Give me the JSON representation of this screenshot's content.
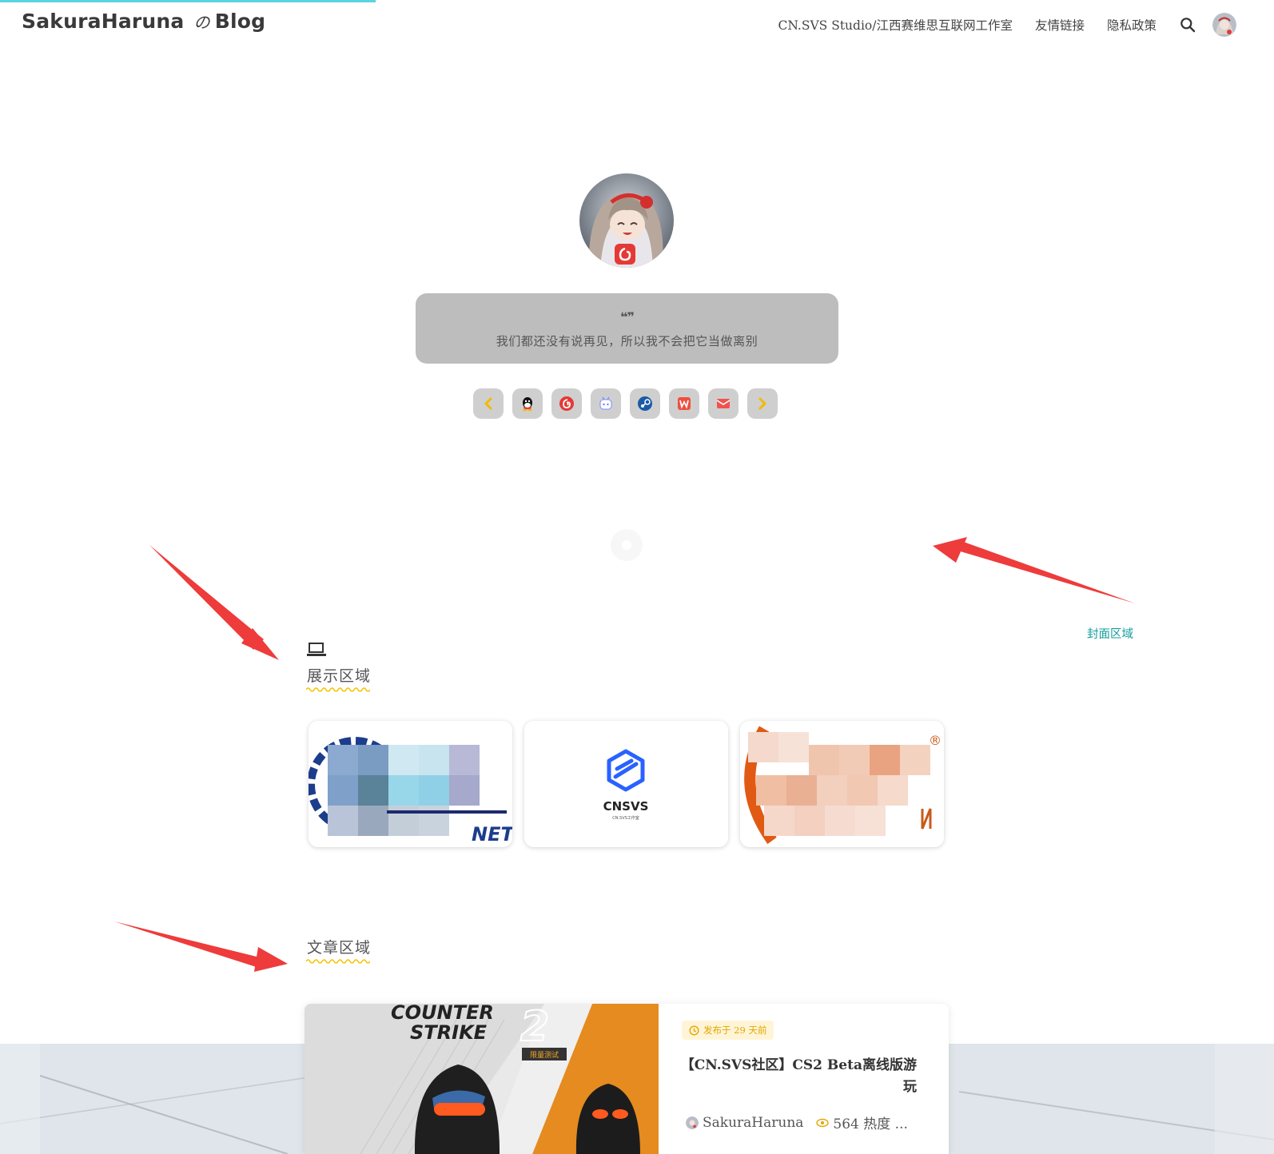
{
  "header": {
    "brand_main": "SakuraHaruna",
    "brand_no": "の",
    "brand_blog": "Blog",
    "nav": [
      {
        "label": "CN.SVS Studio/江西赛维思互联网工作室"
      },
      {
        "label": "友情链接"
      },
      {
        "label": "隐私政策"
      }
    ],
    "icons": {
      "search": "search-icon",
      "avatar": "user-avatar"
    }
  },
  "hero": {
    "quote_mark": "❝❞",
    "quote": "我们都还没有说再见，所以我不会把它当做离别",
    "social_icons": [
      "prev-arrow-icon",
      "qq-icon",
      "netease-music-icon",
      "bilibili-icon",
      "steam-icon",
      "wps-icon",
      "email-icon",
      "next-arrow-icon"
    ]
  },
  "annotations": {
    "cover_label": "封面区域"
  },
  "sections": {
    "showcase_title": "展示区域",
    "articles_title": "文章区域"
  },
  "showcase_cards": [
    {
      "name": "blurred-logo-1",
      "text": "NET"
    },
    {
      "name": "cnsvs-logo",
      "text": "CNSVS",
      "subtext": "CN.SVS工作室"
    },
    {
      "name": "blurred-logo-3",
      "text": "®"
    }
  ],
  "article": {
    "cover_line1": "COUNTER",
    "cover_line2": "STRIKE",
    "cover_num": "2",
    "cover_tag": "限量测试",
    "date": "发布于 29 天前",
    "title": "【CN.SVS社区】CS2 Beta离线版游玩",
    "author": "SakuraHaruna",
    "views": "564 热度 ..."
  },
  "colors": {
    "progress": "#5bd3e0",
    "quote_bg": "#bdbdbd",
    "wavy": "#f5c400",
    "arrow": "#ee3b3b",
    "cover_label": "#139c9c"
  }
}
